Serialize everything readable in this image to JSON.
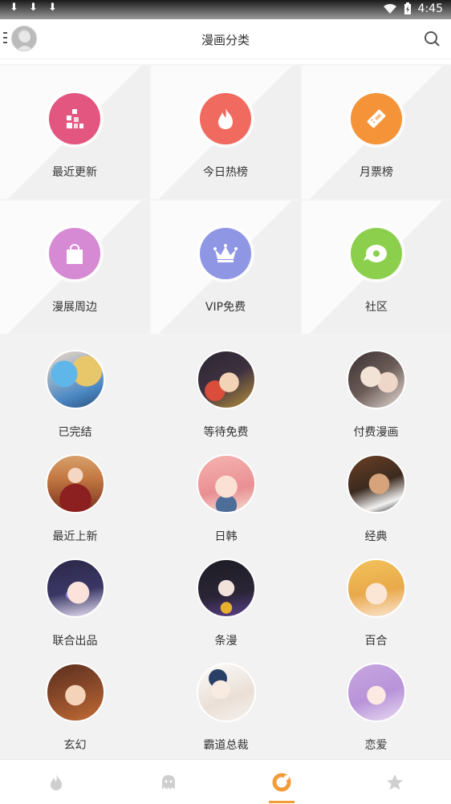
{
  "status_bar": {
    "time": "4:45"
  },
  "header": {
    "title": "漫画分类"
  },
  "features": [
    {
      "label": "最近更新",
      "icon": "recent-update-icon",
      "color": "#e2567f"
    },
    {
      "label": "今日热榜",
      "icon": "flame-icon",
      "color": "#f06a5f"
    },
    {
      "label": "月票榜",
      "icon": "ticket-icon",
      "color": "#f59339"
    },
    {
      "label": "漫展周边",
      "icon": "shopping-bag-icon",
      "color": "#d68ad4"
    },
    {
      "label": "VIP免费",
      "icon": "crown-icon",
      "color": "#8f96e4"
    },
    {
      "label": "社区",
      "icon": "community-icon",
      "color": "#8ccf4c"
    }
  ],
  "categories": [
    {
      "label": "已完结"
    },
    {
      "label": "等待免费"
    },
    {
      "label": "付费漫画"
    },
    {
      "label": "最近上新"
    },
    {
      "label": "日韩"
    },
    {
      "label": "经典"
    },
    {
      "label": "联合出品"
    },
    {
      "label": "条漫"
    },
    {
      "label": "百合"
    },
    {
      "label": "玄幻"
    },
    {
      "label": "霸道总裁"
    },
    {
      "label": "恋爱"
    }
  ],
  "bottom_nav": [
    {
      "icon": "fire-icon",
      "active": false
    },
    {
      "icon": "ghost-icon",
      "active": false
    },
    {
      "icon": "donut-icon",
      "active": true,
      "color": "#f29c38"
    },
    {
      "icon": "star-icon",
      "active": false
    }
  ]
}
